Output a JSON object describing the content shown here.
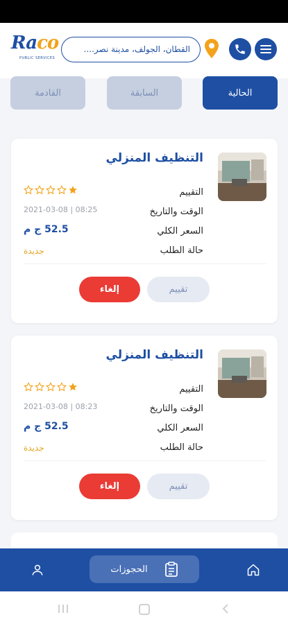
{
  "header": {
    "logo_text": "Raco",
    "logo_subtitle": "PUBLIC SERVICES",
    "search_placeholder": "القطان، الجولف، مدينة نصر....",
    "icons": [
      "location-pin-icon",
      "phone-icon",
      "menu-icon"
    ]
  },
  "tabs": [
    {
      "label": "القادمة",
      "active": false
    },
    {
      "label": "السابقة",
      "active": false
    },
    {
      "label": "الحالية",
      "active": true
    }
  ],
  "bookings": [
    {
      "title": "التنظيف المنزلي",
      "rating_label": "التقييم",
      "datetime_label": "الوقت والتاريخ",
      "total_label": "السعر الكلي",
      "status_label": "حالة الطلب",
      "rating": 1,
      "datetime": "2021-03-08 | 08:25",
      "price": "52.5 ج م",
      "status": "جديدة",
      "rate_button": "تقييم",
      "cancel_button": "إلغاء"
    },
    {
      "title": "التنظيف المنزلي",
      "rating_label": "التقييم",
      "datetime_label": "الوقت والتاريخ",
      "total_label": "السعر الكلي",
      "status_label": "حالة الطلب",
      "rating": 1,
      "datetime": "2021-03-08 | 08:23",
      "price": "52.5 ج م",
      "status": "جديدة",
      "rate_button": "تقييم",
      "cancel_button": "إلغاء"
    }
  ],
  "bottom_nav": {
    "active_label": "الحجوزات",
    "items": [
      "profile-icon",
      "bookings-icon",
      "home-icon"
    ]
  },
  "colors": {
    "primary": "#1e4fa3",
    "accent": "#f2a31b",
    "danger": "#ea3b35"
  }
}
